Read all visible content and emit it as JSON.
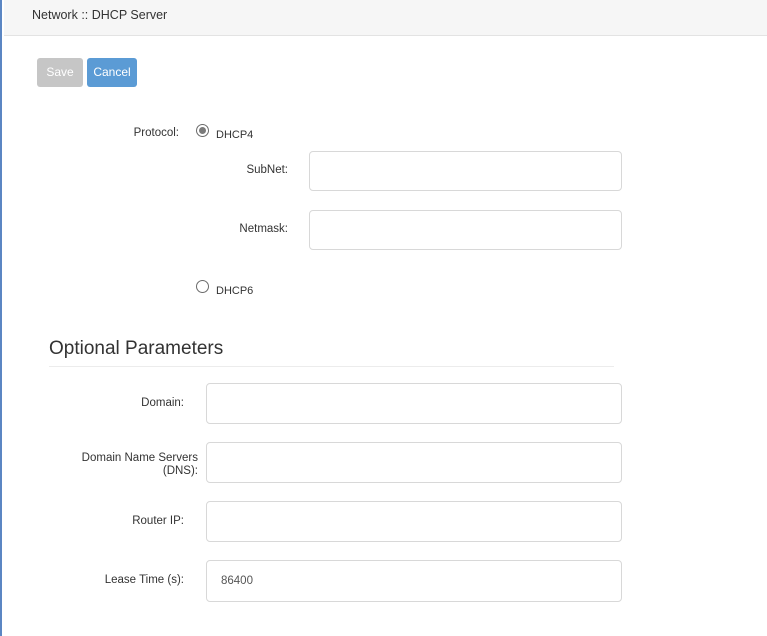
{
  "header": {
    "title": "Network :: DHCP Server"
  },
  "toolbar": {
    "save_label": "Save",
    "cancel_label": "Cancel"
  },
  "protocol": {
    "label": "Protocol:",
    "options": [
      {
        "label": "DHCP4",
        "selected": true
      },
      {
        "label": "DHCP6",
        "selected": false
      }
    ],
    "subnet": {
      "label": "SubNet:",
      "value": ""
    },
    "netmask": {
      "label": "Netmask:",
      "value": ""
    }
  },
  "optional": {
    "title": "Optional Parameters",
    "domain": {
      "label": "Domain:",
      "value": ""
    },
    "dns": {
      "label_line1": "Domain Name Servers",
      "label_line2": "(DNS):",
      "value": ""
    },
    "router_ip": {
      "label": "Router IP:",
      "value": ""
    },
    "lease_time": {
      "label": "Lease Time (s):",
      "value": "86400"
    }
  },
  "colors": {
    "accent": "#5b9bd5",
    "disabled": "#c6c6c6",
    "frame_border": "#5b86c3"
  }
}
